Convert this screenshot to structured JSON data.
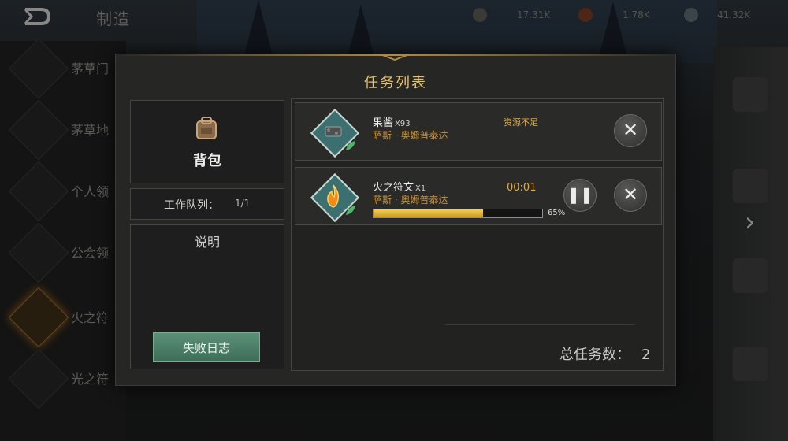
{
  "header": {
    "title": "制造",
    "resources": [
      {
        "icon": "wood-icon",
        "value": "17.31K"
      },
      {
        "icon": "ore-icon",
        "value": "1.78K"
      },
      {
        "icon": "stone-icon",
        "value": "41.32K"
      }
    ]
  },
  "craft_list": [
    {
      "label": "茅草门"
    },
    {
      "label": "茅草地"
    },
    {
      "label": "个人领"
    },
    {
      "label": "公会领"
    },
    {
      "label": "火之符"
    },
    {
      "label": "光之符"
    }
  ],
  "modal": {
    "title": "任务列表",
    "backpack_label": "背包",
    "queue_label": "工作队列：",
    "queue_value": "1/1",
    "description_label": "说明",
    "fail_log_label": "失败日志",
    "total_label": "总任务数：",
    "total_value": "2"
  },
  "tasks": [
    {
      "name": "果酱",
      "qty": "X93",
      "subtitle": "萨斯 · 奥姆普泰达",
      "status": "资源不足",
      "icon": "jam-icon"
    },
    {
      "name": "火之符文",
      "qty": "X1",
      "subtitle": "萨斯 · 奥姆普泰达",
      "timer": "00:01",
      "progress": 0.65,
      "progress_label": "65%",
      "icon": "fire-rune-icon"
    }
  ],
  "colors": {
    "accent_gold": "#e6c06a",
    "status_orange": "#e0a83a",
    "button_green": "#4f8469"
  }
}
